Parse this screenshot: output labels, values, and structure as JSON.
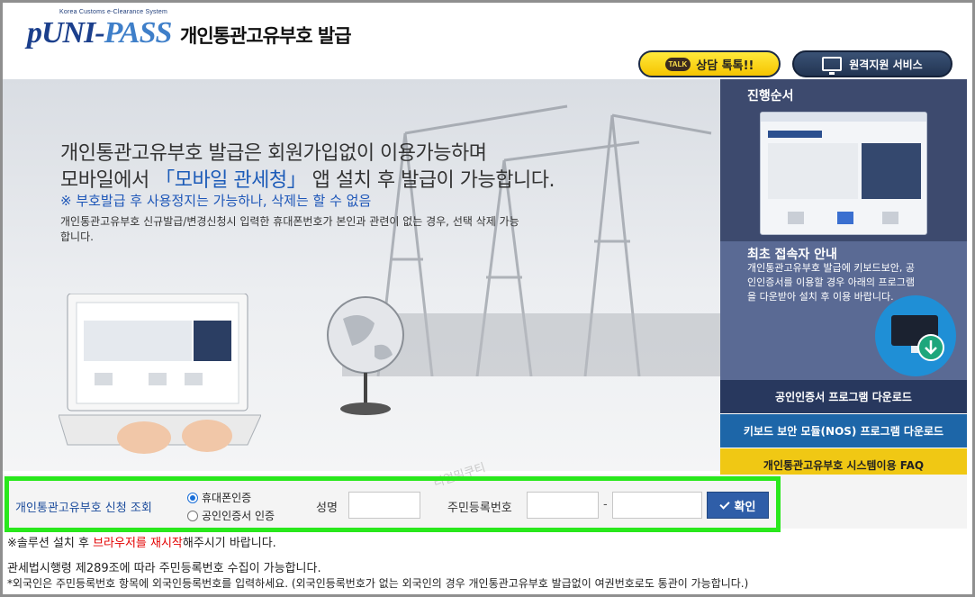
{
  "header": {
    "logo_small": "Korea Customs e-Clearance System",
    "logo_main_a": "UNI-",
    "logo_main_b": "PASS",
    "logo_p": "p",
    "title": "개인통관고유부호 발급",
    "talk_badge": "TALK",
    "talk_label": "상담 톡톡!!",
    "remote_label": "원격지원 서비스"
  },
  "hero": {
    "line1": "개인통관고유부호 발급은 회원가입없이 이용가능하며",
    "line2_pre": "모바일에서 ",
    "line2_hl": "「모바일 관세청」",
    "line2_post": " 앱 설치 후 발급이 가능합니다.",
    "note": "※ 부호발급 후 사용정지는 가능하나, 삭제는 할 수 없음",
    "desc": "개인통관고유부호 신규발급/변경신청시 입력한 휴대폰번호가 본인과 관련이 없는 경우, 선택 삭제 가능합니다."
  },
  "sidebar": {
    "process_title": "진행순서",
    "guide_title": "최초 접속자 안내",
    "guide_text": "개인통관고유부호 발급에 키보드보안, 공인인증서를 이용할 경우 아래의 프로그램을 다운받아 설치 후 이용 바랍니다.",
    "btn_cert": "공인인증서 프로그램 다운로드",
    "btn_keyboard": "키보드 보안 모듈(NOS) 프로그램 다운로드",
    "btn_faq": "개인통관고유부호 시스템이용 FAQ"
  },
  "form": {
    "title": "개인통관고유부호 신청 조회",
    "radio_phone": "휴대폰인증",
    "radio_cert": "공인인증서 인증",
    "name_label": "성명",
    "name_value": "",
    "rrn_label": "주민등록번호",
    "rrn1_value": "",
    "rrn2_value": "",
    "dash": "-",
    "confirm_label": "확인",
    "watermark": "리얼밀쿠티"
  },
  "notices": {
    "line1_pre": "※솔루션 설치 후 ",
    "line1_red": "브라우저를 재시작",
    "line1_post": "해주시기 바랍니다.",
    "line2": "관세법시행령 제289조에 따라 주민등록번호 수집이 가능합니다.",
    "line3": "*외국인은 주민등록번호 항목에 외국인등록번호를 입력하세요.   (외국인등록번호가 없는 외국인의 경우 개인통관고유부호 발급없이 여권번호로도 통관이 가능합니다.)"
  },
  "colors": {
    "accent_blue": "#1c5bb8",
    "highlight_green": "#29e81c",
    "sidebar_navy": "#3d4a6e",
    "faq_yellow": "#f0c814"
  }
}
